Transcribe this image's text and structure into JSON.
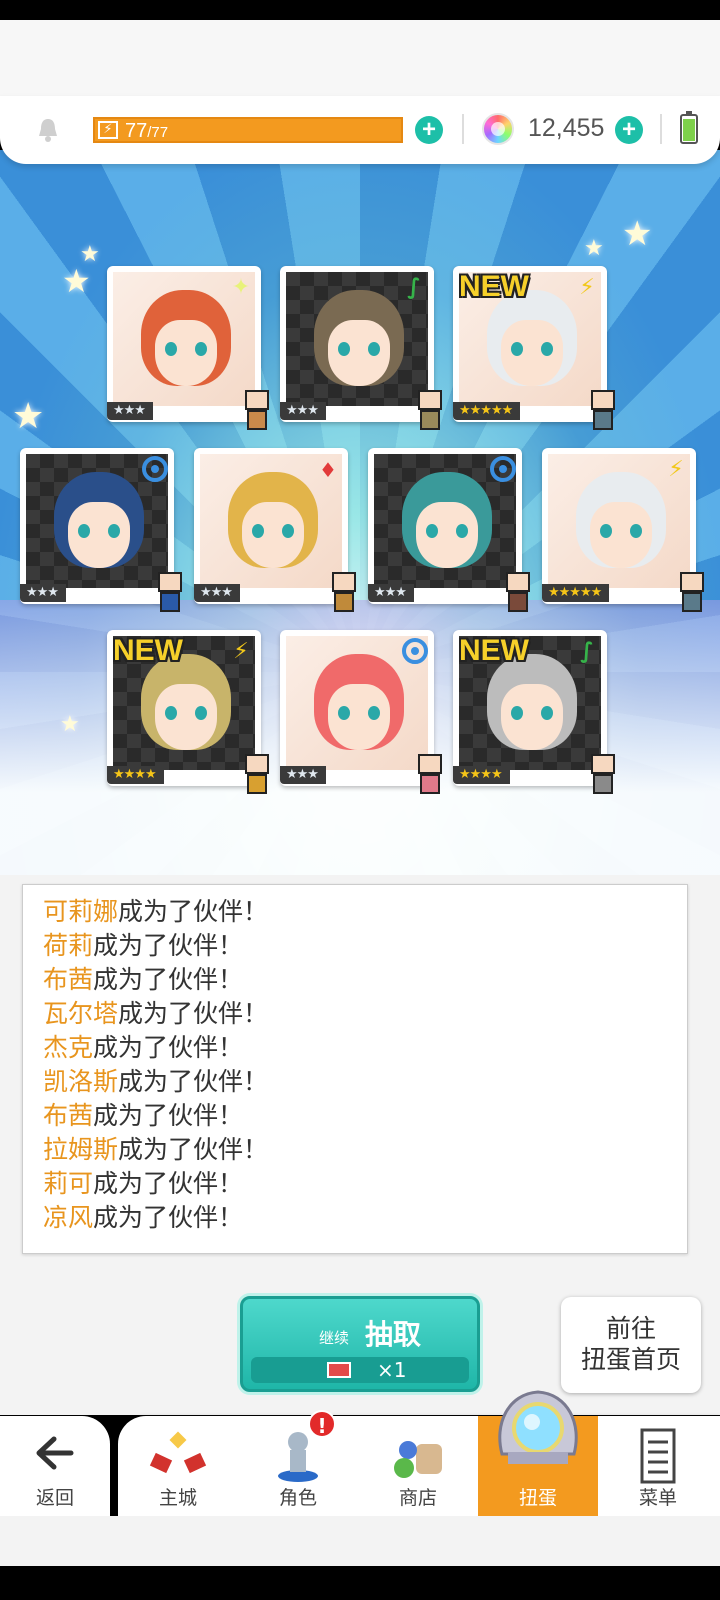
{
  "header": {
    "stamina_current": "77",
    "stamina_max": "/77",
    "gems": "12,455"
  },
  "cards": [
    {
      "id": "card-1",
      "stars": "★★★",
      "element": "light-icon",
      "new": false,
      "hair": "#e0623a",
      "sprite": "#c98a4b"
    },
    {
      "id": "card-2",
      "stars": "★★★",
      "element": "wind-icon",
      "new": false,
      "hair": "#7a6a52",
      "sprite": "#9a8a5a"
    },
    {
      "id": "card-3",
      "stars": "★★★★★",
      "element": "thunder-icon",
      "new": true,
      "hair": "#e8ecef",
      "sprite": "#5a7a8a"
    },
    {
      "id": "card-4",
      "stars": "★★★",
      "element": "water-icon",
      "new": false,
      "hair": "#2a4f8a",
      "sprite": "#2a5aa8"
    },
    {
      "id": "card-5",
      "stars": "★★★",
      "element": "fire-icon",
      "new": false,
      "hair": "#e2b44a",
      "sprite": "#c08a3a"
    },
    {
      "id": "card-6",
      "stars": "★★★",
      "element": "water-icon",
      "new": false,
      "hair": "#3a9a9a",
      "sprite": "#7a4a3a"
    },
    {
      "id": "card-7",
      "stars": "★★★★★",
      "element": "thunder-icon",
      "new": false,
      "hair": "#e8ecef",
      "sprite": "#5a7a8a"
    },
    {
      "id": "card-8",
      "stars": "★★★★",
      "element": "thunder-icon",
      "new": true,
      "hair": "#c8b46a",
      "sprite": "#d8a030"
    },
    {
      "id": "card-9",
      "stars": "★★★",
      "element": "water-icon",
      "new": false,
      "hair": "#f06a6a",
      "sprite": "#e07a8a"
    },
    {
      "id": "card-10",
      "stars": "★★★★",
      "element": "wind-icon",
      "new": true,
      "hair": "#bcbcbc",
      "sprite": "#8a8a8a"
    }
  ],
  "new_label": "NEW",
  "log": [
    {
      "name": "可莉娜",
      "text": "成为了伙伴！"
    },
    {
      "name": "荷莉",
      "text": "成为了伙伴！"
    },
    {
      "name": "布茜",
      "text": "成为了伙伴！"
    },
    {
      "name": "瓦尔塔",
      "text": "成为了伙伴！"
    },
    {
      "name": "杰克",
      "text": "成为了伙伴！"
    },
    {
      "name": "凯洛斯",
      "text": "成为了伙伴！"
    },
    {
      "name": "布茜",
      "text": "成为了伙伴！"
    },
    {
      "name": "拉姆斯",
      "text": "成为了伙伴！"
    },
    {
      "name": "莉可",
      "text": "成为了伙伴！"
    },
    {
      "name": "凉风",
      "text": "成为了伙伴！"
    }
  ],
  "draw": {
    "continue_label": "继续",
    "draw_label": "抽取",
    "cost": "×1"
  },
  "goto": {
    "line1": "前往",
    "line2": "扭蛋首页"
  },
  "nav": {
    "back": "返回",
    "items": [
      "主城",
      "角色",
      "商店",
      "扭蛋",
      "菜单"
    ],
    "badge": "!"
  },
  "colors": {
    "accent_orange": "#f39a1f",
    "teal": "#1fb6a8",
    "name_orange": "#e8951e"
  }
}
